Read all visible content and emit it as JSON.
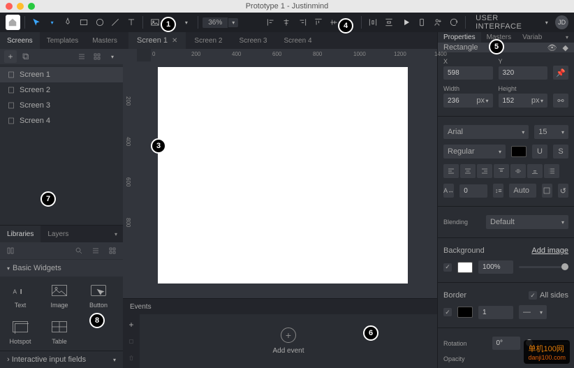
{
  "title": "Prototype 1 - Justinmind",
  "zoom": "36%",
  "userLabel": "USER INTERFACE",
  "avatar": "JD",
  "leftTabs": {
    "screensTab": "Screens",
    "templatesTab": "Templates",
    "mastersTab": "Masters"
  },
  "screens": [
    "Screen 1",
    "Screen 2",
    "Screen 3",
    "Screen 4"
  ],
  "libTabs": {
    "libraries": "Libraries",
    "layers": "Layers"
  },
  "widgetSection": "Basic Widgets",
  "widgets": [
    {
      "name": "Text"
    },
    {
      "name": "Image"
    },
    {
      "name": "Button"
    },
    {
      "name": "Hotspot"
    },
    {
      "name": "Table"
    }
  ],
  "libFoot": "Interactive input fields",
  "canvasTabs": [
    "Screen 1",
    "Screen 2",
    "Screen 3",
    "Screen 4"
  ],
  "rulerH": [
    0,
    200,
    400,
    600,
    800,
    1000,
    1200,
    1400
  ],
  "rulerV": [
    200,
    400,
    600,
    800
  ],
  "events": {
    "head": "Events",
    "add": "Add event"
  },
  "rightTabs": {
    "properties": "Properties",
    "masters": "Masters",
    "variab": "Variab"
  },
  "shape": "Rectangle",
  "pos": {
    "xLabel": "X",
    "x": "598",
    "yLabel": "Y",
    "y": "320"
  },
  "size": {
    "wLabel": "Width",
    "w": "236",
    "wUnit": "px",
    "hLabel": "Height",
    "h": "152",
    "hUnit": "px"
  },
  "font": {
    "family": "Arial",
    "size": "15",
    "weight": "Regular"
  },
  "spacing": {
    "char": "0",
    "line": "Auto"
  },
  "blending": {
    "label": "Blending",
    "value": "Default"
  },
  "background": {
    "label": "Background",
    "addImage": "Add image",
    "value": "100%"
  },
  "border": {
    "label": "Border",
    "allSides": "All sides",
    "value": "1"
  },
  "rotation": {
    "label": "Rotation",
    "value": "0°"
  },
  "opacity": {
    "label": "Opacity"
  },
  "callouts": [
    "1",
    "3",
    "4",
    "5",
    "6",
    "7",
    "8"
  ],
  "watermark": {
    "l1": "单机100网",
    "l2": "danji100.com"
  }
}
